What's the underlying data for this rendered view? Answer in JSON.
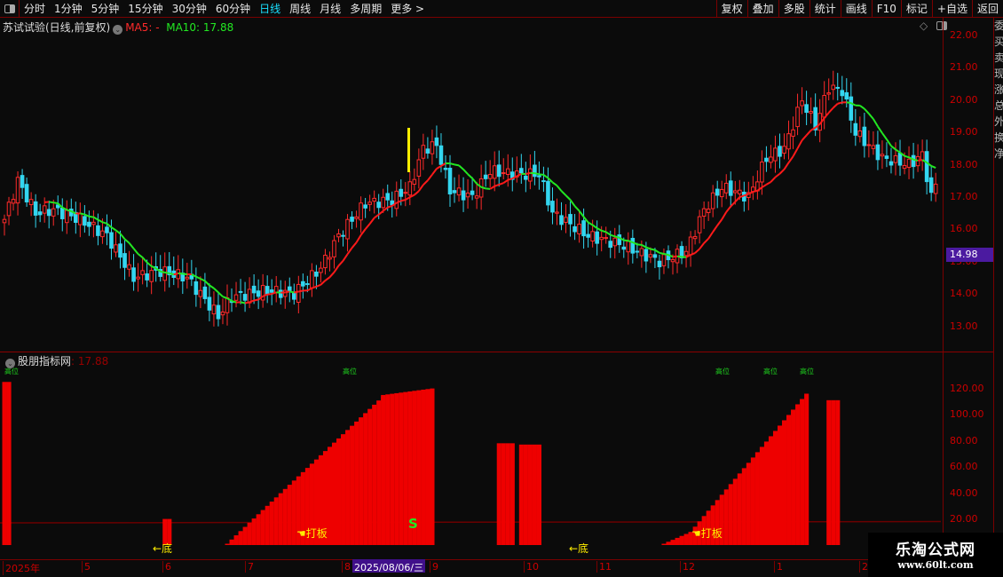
{
  "toolbar": {
    "periods": [
      "分时",
      "1分钟",
      "5分钟",
      "15分钟",
      "30分钟",
      "60分钟",
      "日线",
      "周线",
      "月线",
      "多周期",
      "更多 >"
    ],
    "active": "日线",
    "right_buttons": [
      "复权",
      "叠加",
      "多股",
      "统计",
      "画线",
      "F10",
      "标记",
      "+自选",
      "返回"
    ]
  },
  "main": {
    "title": "苏试试验(日线,前复权)",
    "ma5": "MA5: -",
    "ma10": "MA10: 17.88",
    "price_tag": "14.98",
    "yticks": [
      "22.00",
      "21.00",
      "20.00",
      "19.00",
      "18.00",
      "17.00",
      "16.00",
      "15.00",
      "14.00",
      "13.00"
    ]
  },
  "sub": {
    "title": "股朋指标网",
    "value": ": 17.88",
    "high_label": "高位",
    "bottom_label": "←底",
    "board_label": "打板",
    "s_label": "S",
    "yticks": [
      "120.00",
      "100.00",
      "80.00",
      "60.00",
      "40.00",
      "20.00"
    ]
  },
  "xaxis": {
    "labels": [
      "2025年",
      "5",
      "6",
      "7",
      "8",
      "9",
      "10",
      "11",
      "12",
      "1",
      "2"
    ],
    "selected": "2025/08/06/三"
  },
  "right_strip": "委买卖现涨总外换净",
  "watermark": {
    "name": "乐淘公式网",
    "url": "www.60lt.com"
  },
  "colors": {
    "up": "#ff2a2a",
    "down": "#33d6f0",
    "ma_up": "#ff1a1a",
    "ma_down": "#22e822",
    "bar": "#ee0000"
  },
  "chart_data": {
    "type": "candlestick",
    "ylim": [
      12.7,
      22.2
    ],
    "price_path": [
      [
        0,
        16.3
      ],
      [
        3,
        17.5
      ],
      [
        7,
        16.5
      ],
      [
        11,
        16.6
      ],
      [
        17,
        16.3
      ],
      [
        23,
        15.8
      ],
      [
        29,
        14.5
      ],
      [
        35,
        14.7
      ],
      [
        41,
        14.5
      ],
      [
        48,
        13.3
      ],
      [
        51,
        13.9
      ],
      [
        59,
        14.1
      ],
      [
        65,
        14.0
      ],
      [
        71,
        14.8
      ],
      [
        75,
        15.8
      ],
      [
        81,
        16.8
      ],
      [
        87,
        16.9
      ],
      [
        91,
        17.3
      ],
      [
        94,
        18.5
      ],
      [
        97,
        18.6
      ],
      [
        100,
        17.2
      ],
      [
        105,
        17.0
      ],
      [
        109,
        17.8
      ],
      [
        115,
        17.7
      ],
      [
        120,
        17.7
      ],
      [
        123,
        16.5
      ],
      [
        131,
        15.8
      ],
      [
        139,
        15.5
      ],
      [
        147,
        15.0
      ],
      [
        153,
        15.3
      ],
      [
        157,
        16.6
      ],
      [
        161,
        17.3
      ],
      [
        167,
        17.0
      ],
      [
        171,
        18.2
      ],
      [
        175,
        18.5
      ],
      [
        179,
        20.0
      ],
      [
        182,
        19.2
      ],
      [
        185,
        20.4
      ],
      [
        188,
        20.3
      ],
      [
        191,
        19.0
      ],
      [
        197,
        18.2
      ],
      [
        203,
        18.0
      ],
      [
        206,
        18.3
      ],
      [
        208,
        17.0
      ],
      [
        209,
        17.4
      ]
    ],
    "indicator": {
      "ylim": [
        0,
        125
      ],
      "segments": [
        [
          0,
          1,
          125,
          125
        ],
        [
          36,
          37,
          20,
          20
        ],
        [
          50,
          85,
          1,
          114
        ],
        [
          85,
          96,
          115,
          120
        ],
        [
          111,
          114,
          78,
          78
        ],
        [
          116,
          117,
          77,
          77
        ],
        [
          118,
          120,
          77,
          77
        ],
        [
          148,
          154,
          1,
          10
        ],
        [
          154,
          180,
          10,
          116
        ],
        [
          185,
          187,
          111,
          111
        ]
      ]
    }
  }
}
